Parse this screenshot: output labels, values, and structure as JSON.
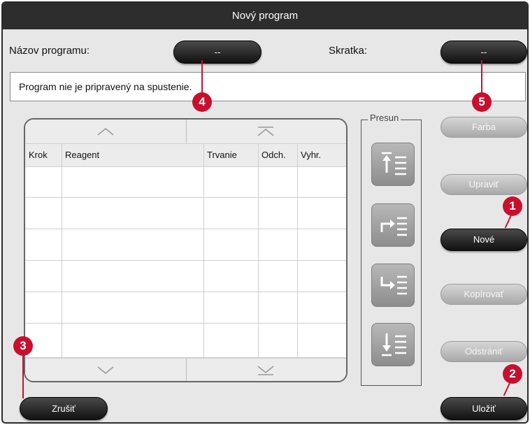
{
  "window": {
    "title": "Nový program"
  },
  "form": {
    "name_label": "Názov programu:",
    "name_value": "--",
    "abbr_label": "Skratka:",
    "abbr_value": "--"
  },
  "status_message": "Program nie je pripravený na spustenie.",
  "table": {
    "columns": [
      "Krok",
      "Reagent",
      "Trvanie",
      "Odch.",
      "Vyhr."
    ],
    "rows": [
      [
        "",
        "",
        "",
        "",
        ""
      ],
      [
        "",
        "",
        "",
        "",
        ""
      ],
      [
        "",
        "",
        "",
        "",
        ""
      ],
      [
        "",
        "",
        "",
        "",
        ""
      ],
      [
        "",
        "",
        "",
        "",
        ""
      ],
      [
        "",
        "",
        "",
        "",
        ""
      ]
    ],
    "icons": {
      "scroll_up": "chevron-up-icon",
      "scroll_top": "double-chevron-up-icon",
      "scroll_down": "chevron-down-icon",
      "scroll_bottom": "double-chevron-down-icon"
    }
  },
  "move_panel": {
    "label": "Presun",
    "icons": [
      "move-to-top-icon",
      "move-up-icon",
      "move-down-icon",
      "move-to-bottom-icon"
    ]
  },
  "buttons": {
    "color": "Farba",
    "edit": "Upraviť",
    "new": "Nové",
    "copy": "Kopírovať",
    "delete": "Odstrániť",
    "cancel": "Zrušiť",
    "save": "Uložiť"
  },
  "callouts": [
    "1",
    "2",
    "3",
    "4",
    "5"
  ],
  "colors": {
    "callout": "#c8102e",
    "titlebar": "#2d2d2d",
    "active_button": "#1a1a1a",
    "disabled_button": "#bdbdbd"
  }
}
